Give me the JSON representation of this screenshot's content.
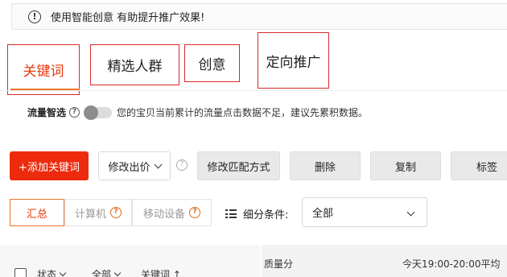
{
  "notice": {
    "icon": "info-icon",
    "text": "使用智能创意 有助提升推广效果!"
  },
  "tabs": [
    {
      "label": "关键词",
      "active": true
    },
    {
      "label": "精选人群",
      "active": false
    },
    {
      "label": "创意",
      "active": false
    },
    {
      "label": "定向推广",
      "active": false
    }
  ],
  "smart_select": {
    "label": "流量智选",
    "help_icon": "question-icon",
    "toggle_on": false,
    "hint": "您的宝贝当前累计的流量点击数据不足，建议先累积数据。"
  },
  "toolbar": {
    "add_keyword": "+添加关键词",
    "modify_bid": "修改出价",
    "modify_match": "修改匹配方式",
    "delete": "删除",
    "copy": "复制",
    "tag": "标签"
  },
  "segments": [
    {
      "label": "汇总",
      "active": true
    },
    {
      "label": "计算机",
      "active": false
    },
    {
      "label": "移动设备",
      "active": false
    }
  ],
  "filter": {
    "label": "细分条件:",
    "selected": "全部"
  },
  "table_header": {
    "status": "状态",
    "all": "全部",
    "keyword": "关键词 ↑",
    "quality": "质量分",
    "today": "今天19:00-20:00平均"
  },
  "colors": {
    "accent": "#ee2a0d",
    "active_text": "#e8380d",
    "highlight_box": "#d62b2b"
  }
}
